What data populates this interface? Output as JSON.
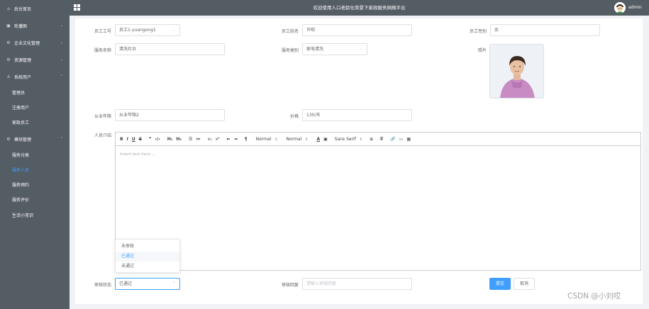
{
  "sidebar": {
    "items": [
      {
        "icon": "home-icon",
        "label": "后台首页",
        "arrow": false
      },
      {
        "icon": "image-icon",
        "label": "轮播图",
        "arrow": true
      },
      {
        "icon": "gear-icon",
        "label": "企业文化管理",
        "arrow": true
      },
      {
        "icon": "gear-icon",
        "label": "资源管理",
        "arrow": true
      },
      {
        "icon": "user-icon",
        "label": "系统用户",
        "arrow": true
      }
    ],
    "users_sub": [
      "管理员",
      "注册用户",
      "家政员工"
    ],
    "module": {
      "icon": "gear-icon",
      "label": "模块管理",
      "arrow": true
    },
    "module_sub": [
      "服务分类",
      "服务人员",
      "服务预约",
      "服务评价",
      "生活小常识"
    ],
    "active_label": "服务人员"
  },
  "topbar": {
    "title": "欢迎使用人口老龄化背景下家政服务网络平台",
    "user": "admin"
  },
  "form": {
    "employee_no": {
      "label": "员工工号",
      "value": "员工1-yuangong1"
    },
    "employee_name": {
      "label": "员工姓名",
      "value": "许昭"
    },
    "employee_gender": {
      "label": "员工性别",
      "value": "女"
    },
    "service_name": {
      "label": "服务名称",
      "value": "清洗灶台"
    },
    "service_type": {
      "label": "服务类别",
      "value": "家电清洗"
    },
    "photo": {
      "label": "照片"
    },
    "experience": {
      "label": "从业年限",
      "value": "从业年限2"
    },
    "price": {
      "label": "价格",
      "value": "130/天"
    },
    "intro": {
      "label": "人员介绍"
    },
    "audit_status": {
      "label": "审核状态",
      "value": "已通过"
    },
    "audit_reply": {
      "label": "审核回复",
      "placeholder": "请输入审核回复"
    }
  },
  "editor": {
    "placeholder": "Insert text here ...",
    "toolbar": {
      "bold": "B",
      "italic": "I",
      "underline": "U",
      "strike": "S",
      "quote": "❞",
      "code": "‹/›",
      "h1": "H₁",
      "h2": "H₂",
      "ordered_list": "☰",
      "bullet_list": "≔",
      "subscript": "x₂",
      "superscript": "x²",
      "indent_left": "⇤",
      "indent_right": "⇥",
      "direction": "¶",
      "size_select": "Normal",
      "header_select": "Normal",
      "color": "A",
      "background": "▣",
      "font_select": "Sans Serif",
      "align": "≡",
      "clean": "T̶",
      "link": "🔗",
      "image": "▭",
      "video": "▦"
    }
  },
  "dropdown": {
    "options": [
      "未审核",
      "已通过",
      "未通过"
    ],
    "selected": "已通过"
  },
  "buttons": {
    "submit": "提交",
    "cancel": "取消"
  },
  "watermark": "CSDN @小刘哎",
  "colors": {
    "sidebar_bg": "#545c64",
    "accent": "#409eff"
  }
}
